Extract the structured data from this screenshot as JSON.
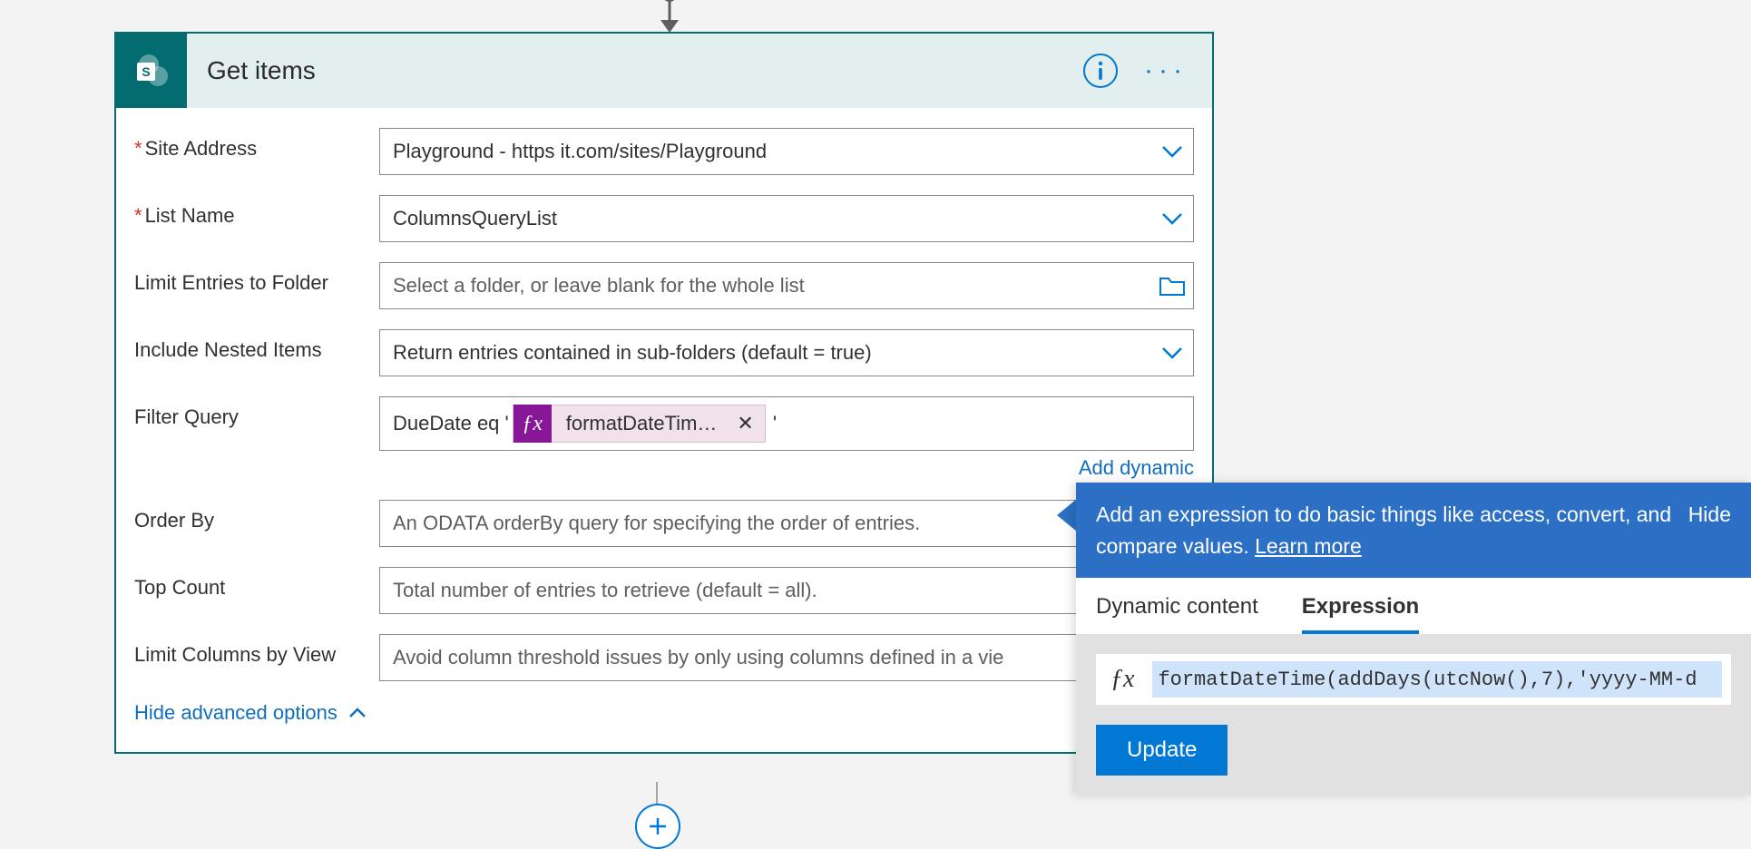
{
  "card": {
    "title": "Get items",
    "rows": {
      "site_address": {
        "label": "Site Address",
        "value": "Playground - https                                 it.com/sites/Playground"
      },
      "list_name": {
        "label": "List Name",
        "value": "ColumnsQueryList"
      },
      "limit_folder": {
        "label": "Limit Entries to Folder",
        "placeholder": "Select a folder, or leave blank for the whole list"
      },
      "nested": {
        "label": "Include Nested Items",
        "value": "Return entries contained in sub-folders (default = true)"
      },
      "filter": {
        "label": "Filter Query",
        "prefix": "DueDate eq '",
        "token_label": "formatDateTim…",
        "suffix": "'"
      },
      "order_by": {
        "label": "Order By",
        "placeholder": "An ODATA orderBy query for specifying the order of entries."
      },
      "top_count": {
        "label": "Top Count",
        "placeholder": "Total number of entries to retrieve (default = all)."
      },
      "limit_view": {
        "label": "Limit Columns by View",
        "placeholder": "Avoid column threshold issues by only using columns defined in a vie"
      }
    },
    "add_dynamic": "Add dynamic",
    "hide_advanced": "Hide advanced options"
  },
  "flyout": {
    "desc": "Add an expression to do basic things like access, convert, and compare values. ",
    "learn": "Learn more",
    "hide": "Hide",
    "tabs": {
      "dynamic": "Dynamic content",
      "expression": "Expression"
    },
    "expression_text": "formatDateTime(addDays(utcNow(),7),'yyyy-MM-d",
    "update": "Update"
  }
}
